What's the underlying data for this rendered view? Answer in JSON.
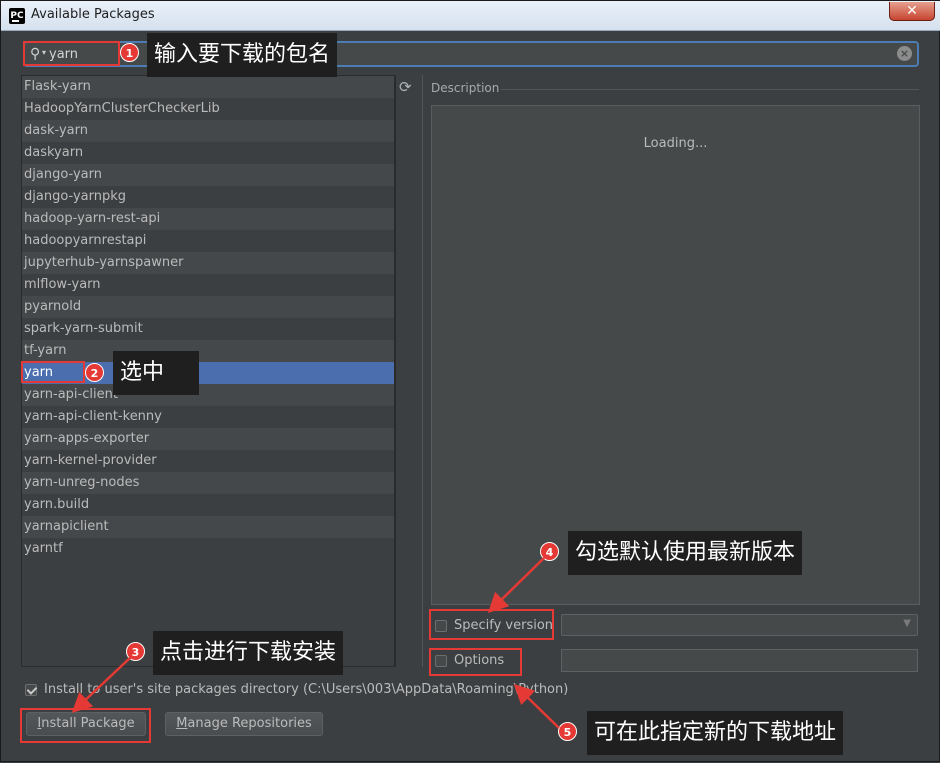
{
  "window": {
    "title": "Available Packages",
    "app_icon_text": "PC",
    "close_glyph": "✕"
  },
  "search": {
    "value": "yarn",
    "icon": "search-icon",
    "clear_glyph": "×"
  },
  "packages": [
    "Flask-yarn",
    "HadoopYarnClusterCheckerLib",
    "dask-yarn",
    "daskyarn",
    "django-yarn",
    "django-yarnpkg",
    "hadoop-yarn-rest-api",
    "hadoopyarnrestapi",
    "jupyterhub-yarnspawner",
    "mlflow-yarn",
    "pyarnold",
    "spark-yarn-submit",
    "tf-yarn",
    "yarn",
    "yarn-api-client",
    "yarn-api-client-kenny",
    "yarn-apps-exporter",
    "yarn-kernel-provider",
    "yarn-unreg-nodes",
    "yarn.build",
    "yarnapiclient",
    "yarntf"
  ],
  "selected_package": "yarn",
  "description": {
    "label": "Description",
    "loading_text": "Loading..."
  },
  "specify_version": {
    "label": "Specify version",
    "checked": false,
    "selected_value": ""
  },
  "options": {
    "label": "Options",
    "checked": false,
    "value": ""
  },
  "install_to_user": {
    "label": "Install to user's site packages directory (C:\\Users\\003\\AppData\\Roaming\\Python)",
    "checked": true
  },
  "buttons": {
    "install_mnemonic": "I",
    "install_rest": "nstall Package",
    "manage_mnemonic": "M",
    "manage_rest": "anage Repositories"
  },
  "annotations": {
    "badge_1": "1",
    "callout_1": "输入要下载的包名",
    "badge_2": "2",
    "callout_2": "选中",
    "badge_3": "3",
    "callout_3": "点击进行下载安装",
    "badge_4": "4",
    "callout_4": "勾选默认使用最新版本",
    "badge_5": "5",
    "callout_5": "可在此指定新的下载地址",
    "color": "#e53935"
  }
}
